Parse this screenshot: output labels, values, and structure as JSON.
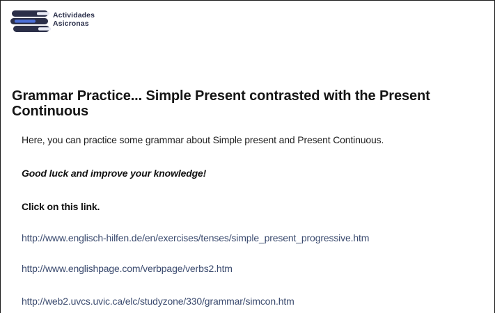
{
  "logo": {
    "name": "Actividades Asicronas",
    "line1": "Actividades",
    "line2": "Asicronas",
    "icon": "books-stack-icon",
    "colors": {
      "dark": "#2b2f48",
      "light": "#e8eaf4",
      "accent": "#4b6fd6"
    }
  },
  "page": {
    "title": "Grammar Practice... Simple Present contrasted with the Present Continuous",
    "intro": "Here, you can practice some grammar about Simple present and Present Continuous.",
    "good_luck": "Good luck and improve your knowledge!",
    "click_prompt": "Click on this link."
  },
  "links": [
    {
      "url": "http://www.englisch-hilfen.de/en/exercises/tenses/simple_present_progressive.htm"
    },
    {
      "url": "http://www.englishpage.com/verbpage/verbs2.htm"
    },
    {
      "url": "http://web2.uvcs.uvic.ca/elc/studyzone/330/grammar/simcon.htm"
    }
  ],
  "colors": {
    "link": "#3a4a6e",
    "text": "#111111",
    "border": "#1a1a1a"
  }
}
